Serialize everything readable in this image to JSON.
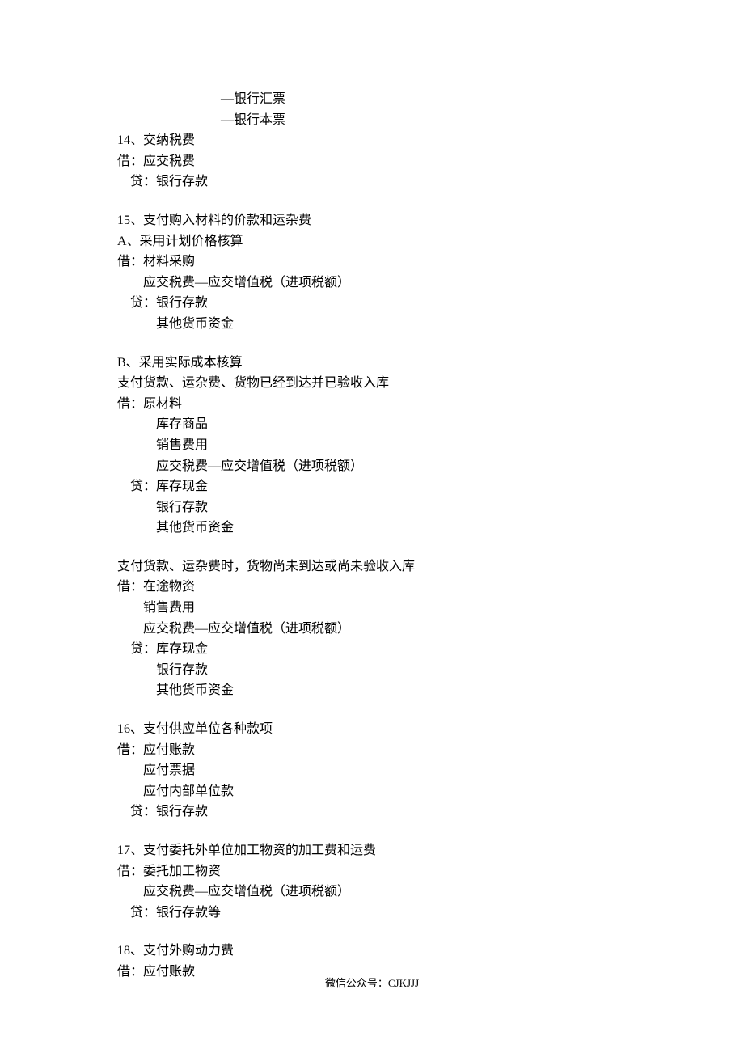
{
  "header": {
    "line1": "—银行汇票",
    "line2": "—银行本票"
  },
  "sections": [
    {
      "title": "14、交纳税费",
      "lines": [
        "借：应交税费",
        "　贷：银行存款"
      ]
    },
    {
      "title": "15、支付购入材料的价款和运杂费",
      "lines": [
        "A、采用计划价格核算",
        "借：材料采购",
        "　　应交税费—应交增值税（进项税额）",
        "　贷：银行存款",
        "　　　其他货币资金"
      ]
    },
    {
      "title": "B、采用实际成本核算",
      "lines": [
        "支付货款、运杂费、货物已经到达并已验收入库",
        "借：原材料",
        "　　　库存商品",
        "　　　销售费用",
        "　　　应交税费—应交增值税（进项税额）",
        "　贷：库存现金",
        "　　　银行存款",
        "　　　其他货币资金"
      ]
    },
    {
      "title": "支付货款、运杂费时，货物尚未到达或尚未验收入库",
      "lines": [
        "借：在途物资",
        "　　销售费用",
        "　　应交税费—应交增值税（进项税额）",
        "　贷：库存现金",
        "　　　银行存款",
        "　　　其他货币资金"
      ]
    },
    {
      "title": "16、支付供应单位各种款项",
      "lines": [
        "借：应付账款",
        "　　应付票据",
        "　　应付内部单位款",
        "　贷：银行存款"
      ]
    },
    {
      "title": "17、支付委托外单位加工物资的加工费和运费",
      "lines": [
        "借：委托加工物资",
        "　　应交税费—应交增值税（进项税额）",
        "　贷：银行存款等"
      ]
    },
    {
      "title": "18、支付外购动力费",
      "lines": [
        "借：应付账款"
      ]
    }
  ],
  "footer": "微信公众号：CJKJJJ"
}
